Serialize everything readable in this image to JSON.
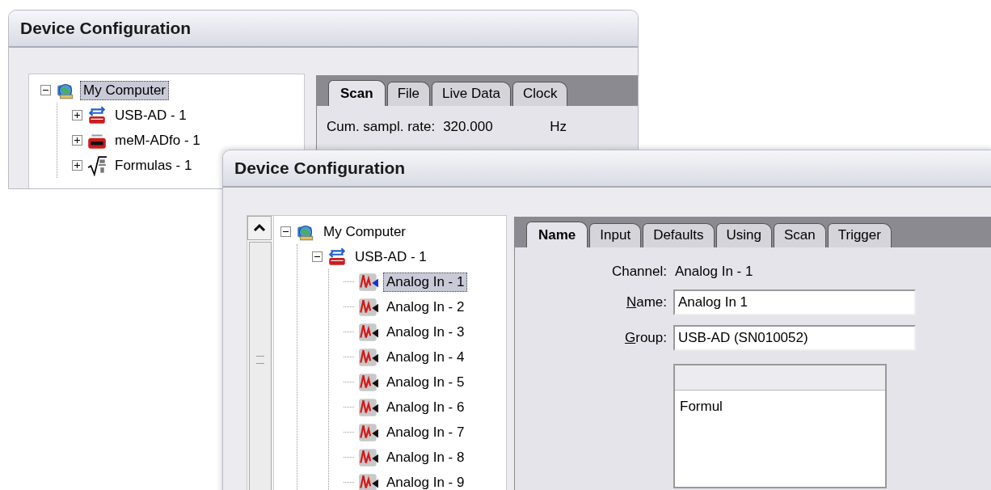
{
  "back_window": {
    "title": "Device Configuration",
    "tree": [
      {
        "label": "My Computer",
        "kind": "computer",
        "expanded": true,
        "selected": true,
        "children": [
          {
            "label": "USB-AD - 1",
            "kind": "usb-device",
            "expanded": false,
            "selected": false
          },
          {
            "label": "meM-ADfo - 1",
            "kind": "meter-device",
            "expanded": false,
            "selected": false
          },
          {
            "label": "Formulas - 1",
            "kind": "formula",
            "expanded": false,
            "selected": false
          }
        ]
      }
    ],
    "tabs": [
      {
        "label": "Scan",
        "selected": true
      },
      {
        "label": "File",
        "selected": false
      },
      {
        "label": "Live Data",
        "selected": false
      },
      {
        "label": "Clock",
        "selected": false
      }
    ],
    "rate": {
      "label": "Cum. sampl. rate:",
      "value": "320.000",
      "unit": "Hz"
    }
  },
  "front_window": {
    "title": "Device Configuration",
    "tree": [
      {
        "label": "My Computer",
        "kind": "computer",
        "expanded": true,
        "selected": false,
        "children": [
          {
            "label": "USB-AD - 1",
            "kind": "usb-device",
            "expanded": true,
            "selected": false,
            "children": [
              {
                "label": "Analog In - 1",
                "kind": "analog-input",
                "selected": true
              },
              {
                "label": "Analog In - 2",
                "kind": "analog-input",
                "selected": false
              },
              {
                "label": "Analog In - 3",
                "kind": "analog-input",
                "selected": false
              },
              {
                "label": "Analog In - 4",
                "kind": "analog-input",
                "selected": false
              },
              {
                "label": "Analog In - 5",
                "kind": "analog-input",
                "selected": false
              },
              {
                "label": "Analog In - 6",
                "kind": "analog-input",
                "selected": false
              },
              {
                "label": "Analog In - 7",
                "kind": "analog-input",
                "selected": false
              },
              {
                "label": "Analog In - 8",
                "kind": "analog-input",
                "selected": false
              },
              {
                "label": "Analog In - 9",
                "kind": "analog-input",
                "selected": false
              }
            ]
          }
        ]
      }
    ],
    "tabs": [
      {
        "label": "Name",
        "selected": true
      },
      {
        "label": "Input",
        "selected": false
      },
      {
        "label": "Defaults",
        "selected": false
      },
      {
        "label": "Using",
        "selected": false
      },
      {
        "label": "Scan",
        "selected": false
      },
      {
        "label": "Trigger",
        "selected": false
      }
    ],
    "channel": {
      "label": "Channel:",
      "value": "Analog In - 1"
    },
    "fields": [
      {
        "label": "Name:",
        "value": "Analog In 1"
      },
      {
        "label": "Group:",
        "value": "USB-AD (SN010052)"
      }
    ],
    "formula_list": {
      "text": "Formul"
    }
  }
}
